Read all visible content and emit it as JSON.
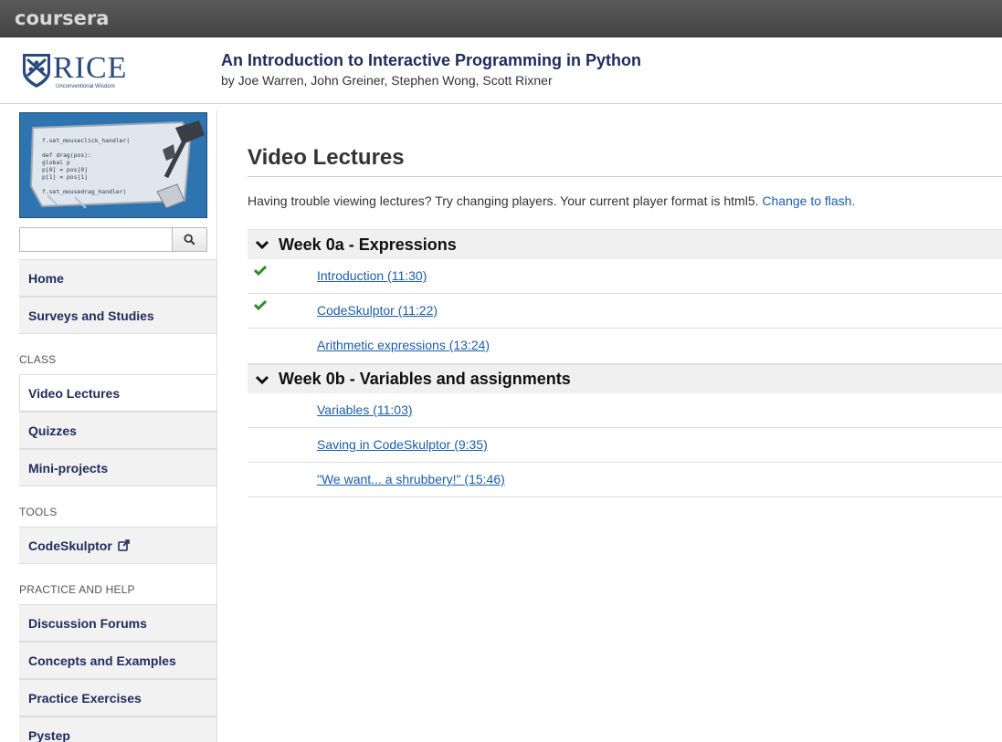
{
  "topbar": {
    "brand": "coursera"
  },
  "header": {
    "logo_text": "RICE",
    "logo_tagline": "Unconventional Wisdom",
    "course_title": "An Introduction to Interactive Programming in Python",
    "authors": "by Joe Warren, John Greiner, Stephen Wong, Scott Rixner"
  },
  "sidebar": {
    "course_image_code": [
      "f.set_mouseclick_handler(",
      "def drag(pos):",
      "    global p",
      "    p[0] = pos[0]",
      "    p[1] = pos[1]",
      "f.set_mousedrag_handler("
    ],
    "search": {
      "value": "",
      "placeholder": ""
    },
    "top_items": [
      {
        "label": "Home"
      },
      {
        "label": "Surveys and Studies"
      }
    ],
    "sections": [
      {
        "title": "CLASS",
        "items": [
          {
            "label": "Video Lectures",
            "active": true
          },
          {
            "label": "Quizzes"
          },
          {
            "label": "Mini-projects"
          }
        ]
      },
      {
        "title": "TOOLS",
        "items": [
          {
            "label": "CodeSkulptor",
            "external": true
          }
        ]
      },
      {
        "title": "PRACTICE AND HELP",
        "items": [
          {
            "label": "Discussion Forums"
          },
          {
            "label": "Concepts and Examples"
          },
          {
            "label": "Practice Exercises"
          },
          {
            "label": "Pystep"
          }
        ]
      }
    ]
  },
  "main": {
    "title": "Video Lectures",
    "notice_text": "Having trouble viewing lectures? Try changing players. Your current player format is html5. ",
    "notice_link": "Change to flash.",
    "weeks": [
      {
        "title": "Week 0a - Expressions",
        "lectures": [
          {
            "title": "Introduction (11:30)",
            "watched": true
          },
          {
            "title": "CodeSkulptor (11:22)",
            "watched": true
          },
          {
            "title": "Arithmetic expressions (13:24)",
            "watched": false
          }
        ]
      },
      {
        "title": "Week 0b - Variables and assignments",
        "lectures": [
          {
            "title": "Variables (11:03)",
            "watched": false
          },
          {
            "title": "Saving in CodeSkulptor (9:35)",
            "watched": false
          },
          {
            "title": "\"We want... a shrubbery!\" (15:46)",
            "watched": false
          }
        ]
      }
    ]
  },
  "colors": {
    "link": "#1d5da8",
    "nav_text": "#1f2b5c",
    "check": "#2e8b2e",
    "topbar": "#4d4d4d"
  }
}
